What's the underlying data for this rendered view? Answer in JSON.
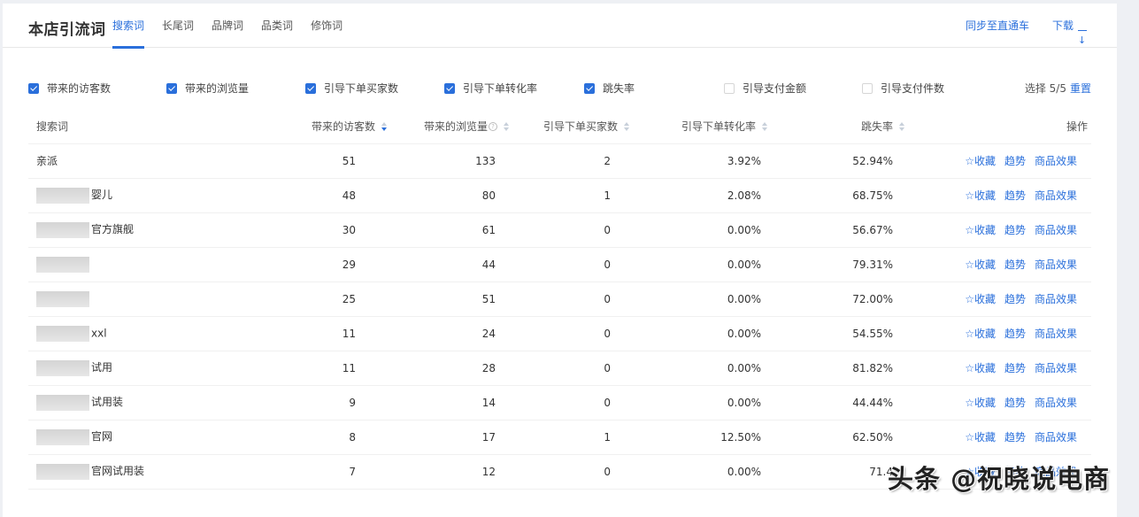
{
  "header": {
    "title": "本店引流词",
    "tabs": [
      {
        "label": "搜索词",
        "active": true
      },
      {
        "label": "长尾词",
        "active": false
      },
      {
        "label": "品牌词",
        "active": false
      },
      {
        "label": "品类词",
        "active": false
      },
      {
        "label": "修饰词",
        "active": false
      }
    ],
    "sync_label": "同步至直通车",
    "download_label": "下载"
  },
  "filters": {
    "items": [
      {
        "label": "带来的访客数",
        "checked": true
      },
      {
        "label": "带来的浏览量",
        "checked": true
      },
      {
        "label": "引导下单买家数",
        "checked": true
      },
      {
        "label": "引导下单转化率",
        "checked": true
      },
      {
        "label": "跳失率",
        "checked": true
      },
      {
        "label": "引导支付金额",
        "checked": false
      },
      {
        "label": "引导支付件数",
        "checked": false
      }
    ],
    "selected_label": "选择 5/5",
    "reset_label": "重置"
  },
  "table": {
    "columns": [
      "搜索词",
      "带来的访客数",
      "带来的浏览量",
      "引导下单买家数",
      "引导下单转化率",
      "跳失率",
      "操作"
    ],
    "actions": {
      "favorite": "收藏",
      "trend": "趋势",
      "product_effect": "商品效果"
    },
    "rows": [
      {
        "keyword": "亲派",
        "blurred": false,
        "visitors": "51",
        "views": "133",
        "buyers": "2",
        "conversion": "3.92%",
        "bounce": "52.94%"
      },
      {
        "keyword": "婴儿",
        "blurred": true,
        "visitors": "48",
        "views": "80",
        "buyers": "1",
        "conversion": "2.08%",
        "bounce": "68.75%"
      },
      {
        "keyword": "官方旗舰",
        "blurred": true,
        "visitors": "30",
        "views": "61",
        "buyers": "0",
        "conversion": "0.00%",
        "bounce": "56.67%"
      },
      {
        "keyword": "",
        "blurred": true,
        "visitors": "29",
        "views": "44",
        "buyers": "0",
        "conversion": "0.00%",
        "bounce": "79.31%"
      },
      {
        "keyword": "",
        "blurred": true,
        "visitors": "25",
        "views": "51",
        "buyers": "0",
        "conversion": "0.00%",
        "bounce": "72.00%"
      },
      {
        "keyword": "xxl",
        "blurred": true,
        "visitors": "11",
        "views": "24",
        "buyers": "0",
        "conversion": "0.00%",
        "bounce": "54.55%"
      },
      {
        "keyword": "试用",
        "blurred": true,
        "visitors": "11",
        "views": "28",
        "buyers": "0",
        "conversion": "0.00%",
        "bounce": "81.82%"
      },
      {
        "keyword": "试用装",
        "blurred": true,
        "visitors": "9",
        "views": "14",
        "buyers": "0",
        "conversion": "0.00%",
        "bounce": "44.44%"
      },
      {
        "keyword": "官网",
        "blurred": true,
        "visitors": "8",
        "views": "17",
        "buyers": "1",
        "conversion": "12.50%",
        "bounce": "62.50%"
      },
      {
        "keyword": "官网试用装",
        "blurred": true,
        "visitors": "7",
        "views": "12",
        "buyers": "0",
        "conversion": "0.00%",
        "bounce": "71.4"
      }
    ]
  },
  "watermark": "头条 @祝晓说电商",
  "colors": {
    "accent": "#2a6fdb",
    "background": "#eef0f4"
  }
}
